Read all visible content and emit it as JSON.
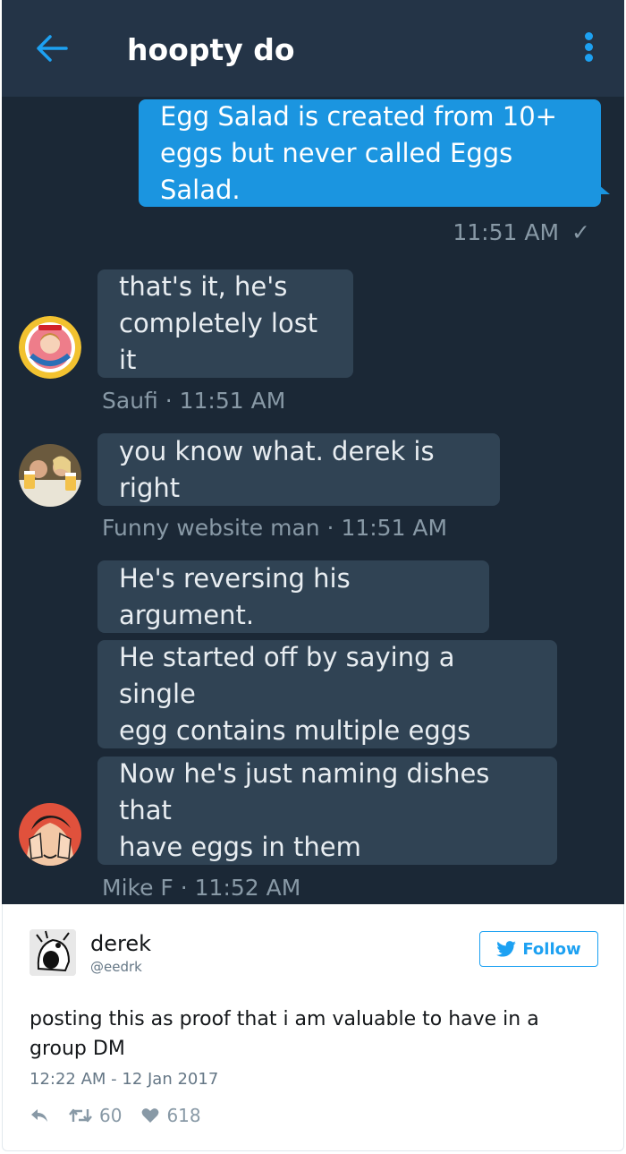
{
  "dm": {
    "title": "hoopty do",
    "messages": [
      {
        "text_lines": [
          "Egg Salad is created from 10+",
          "eggs but never called Eggs Salad."
        ],
        "meta": "11:51 AM"
      },
      {
        "text_lines": [
          "that's it, he's",
          "completely lost it"
        ],
        "meta": "Saufi · 11:51 AM"
      },
      {
        "text_lines": [
          "you know what. derek is right"
        ],
        "meta": "Funny website man · 11:51 AM"
      },
      {
        "text_lines": [
          "He's reversing his argument."
        ]
      },
      {
        "text_lines": [
          "He started off by saying a single",
          "egg contains multiple eggs"
        ]
      },
      {
        "text_lines": [
          "Now he's just naming dishes that",
          "have eggs in them"
        ],
        "meta": "Mike F · 11:52 AM"
      }
    ],
    "icons": {
      "back": "arrow-left-icon",
      "more": "more-vertical-icon",
      "read": "checkmark-icon"
    },
    "colors": {
      "background": "#1b2836",
      "header": "#243447",
      "sent_bubble": "#1b95e0",
      "received_bubble": "#304354",
      "accent": "#1da1f2"
    }
  },
  "tweet": {
    "name": "derek",
    "handle": "@eedrk",
    "follow_label": "Follow",
    "text": "posting this as proof that i am valuable to have in a group DM",
    "timestamp": "12:22 AM - 12 Jan 2017",
    "retweets": "60",
    "likes": "618",
    "icons": {
      "reply": "reply-icon",
      "retweet": "retweet-icon",
      "like": "heart-icon",
      "bird": "twitter-bird-icon"
    }
  }
}
